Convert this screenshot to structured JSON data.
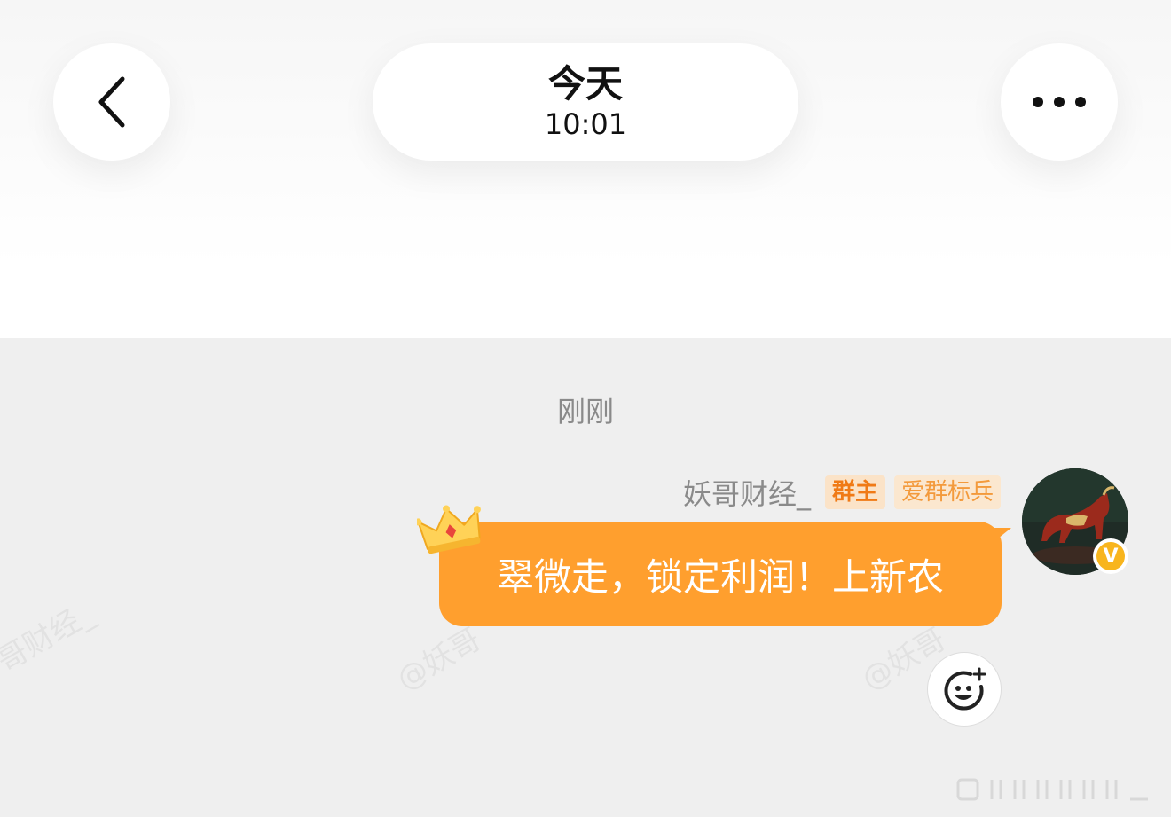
{
  "header": {
    "title": "今天",
    "time": "10:01",
    "back_icon": "chevron-left-icon",
    "more_icon": "more-dots-icon"
  },
  "chat": {
    "time_label": "刚刚",
    "message": {
      "sender": "妖哥财经_",
      "badges": [
        "群主",
        "爱群标兵"
      ],
      "text": "翠微走，锁定利润！上新农",
      "bubble_color": "#ff9f2e"
    },
    "watermarks": [
      "哥财经_",
      "@妖哥",
      "@妖哥"
    ],
    "avatar_icon": "bull-avatar",
    "verified_icon": "v-badge-icon",
    "verified_letter": "V",
    "emoji_icon": "add-reaction-icon"
  },
  "colors": {
    "accent": "#ff9f2e",
    "owner_badge": "#f07a16",
    "background": "#efefef"
  }
}
